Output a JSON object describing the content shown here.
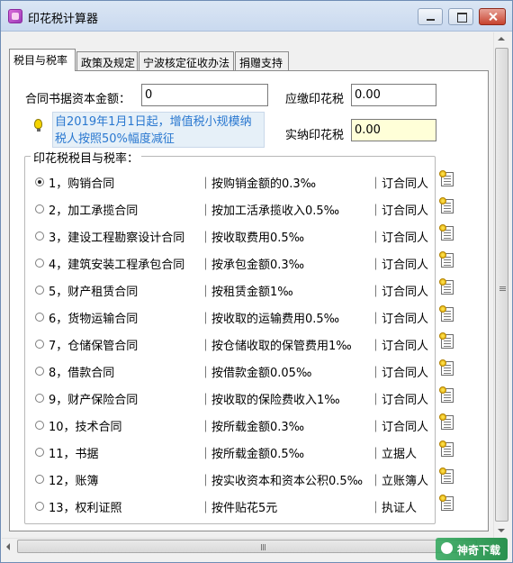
{
  "window": {
    "title": "印花税计算器"
  },
  "tabs": [
    {
      "label": "税目与税率",
      "active": true
    },
    {
      "label": "政策及规定",
      "active": false
    },
    {
      "label": "宁波核定征收办法",
      "active": false
    },
    {
      "label": "捐赠支持",
      "active": false
    }
  ],
  "form": {
    "capital_label": "合同书据资本金额：",
    "capital_value": "0",
    "payable_label": "应缴印花税",
    "payable_value": "0.00",
    "actual_label": "实纳印花税",
    "actual_value": "0.00"
  },
  "notice": {
    "text": "自2019年1月1日起，增值税小规模纳税人按照50%幅度减征"
  },
  "items_group": {
    "title": "印花税税目与税率："
  },
  "items": [
    {
      "name": "1，购销合同",
      "rate": "｜按购销金额的0.3‰",
      "party": "｜订合同人",
      "selected": true
    },
    {
      "name": "2，加工承揽合同",
      "rate": "｜按加工活承揽收入0.5‰",
      "party": "｜订合同人",
      "selected": false
    },
    {
      "name": "3，建设工程勘察设计合同",
      "rate": "｜按收取费用0.5‰",
      "party": "｜订合同人",
      "selected": false
    },
    {
      "name": "4，建筑安装工程承包合同",
      "rate": "｜按承包金额0.3‰",
      "party": "｜订合同人",
      "selected": false
    },
    {
      "name": "5，财产租赁合同",
      "rate": "｜按租赁金额1‰",
      "party": "｜订合同人",
      "selected": false
    },
    {
      "name": "6，货物运输合同",
      "rate": "｜按收取的运输费用0.5‰",
      "party": "｜订合同人",
      "selected": false
    },
    {
      "name": "7，仓储保管合同",
      "rate": "｜按仓储收取的保管费用1‰",
      "party": "｜订合同人",
      "selected": false
    },
    {
      "name": "8，借款合同",
      "rate": "｜按借款金额0.05‰",
      "party": "｜订合同人",
      "selected": false
    },
    {
      "name": "9，财产保险合同",
      "rate": "｜按收取的保险费收入1‰",
      "party": "｜订合同人",
      "selected": false
    },
    {
      "name": "10，技术合同",
      "rate": "｜按所载金额0.3‰",
      "party": "｜订合同人",
      "selected": false
    },
    {
      "name": "11，书据",
      "rate": "｜按所载金额0.5‰",
      "party": "｜立据人",
      "selected": false
    },
    {
      "name": "12，账簿",
      "rate": "｜按实收资本和资本公积0.5‰",
      "party": "｜立账簿人",
      "selected": false
    },
    {
      "name": "13，权利证照",
      "rate": "｜按件贴花5元",
      "party": "｜执证人",
      "selected": false
    }
  ],
  "watermark": {
    "text": "神奇下载"
  }
}
